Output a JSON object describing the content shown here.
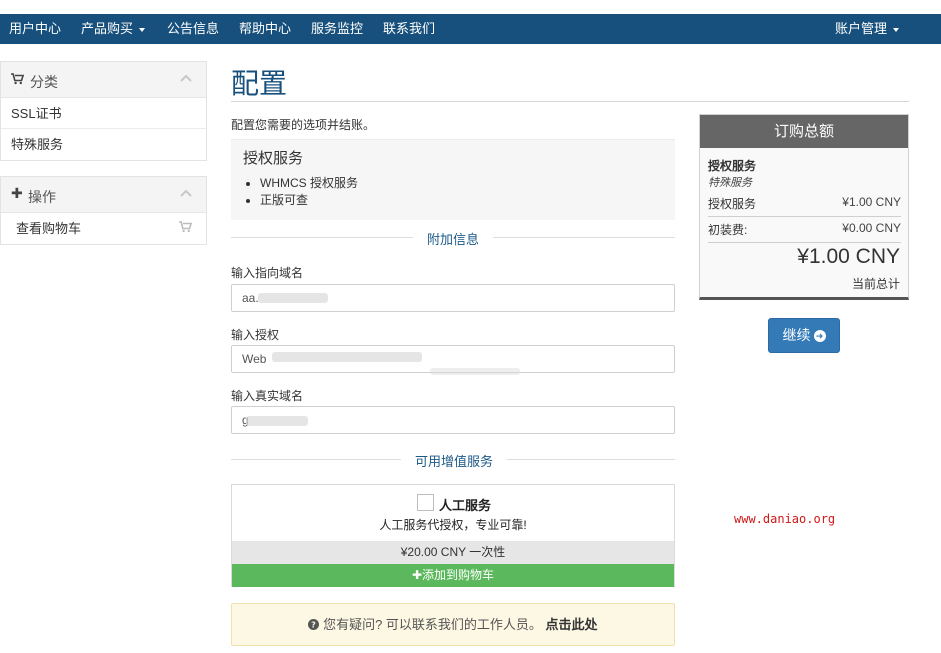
{
  "nav": {
    "items": [
      "用户中心",
      "产品购买",
      "公告信息",
      "帮助中心",
      "服务监控",
      "联系我们"
    ],
    "account": "账户管理"
  },
  "sidebar": {
    "categories": {
      "title": "分类",
      "items": [
        "SSL证书",
        "特殊服务"
      ]
    },
    "actions": {
      "title": "操作",
      "items": [
        "查看购物车"
      ]
    }
  },
  "main": {
    "title": "配置",
    "intro": "配置您需要的选项并结账。",
    "product": {
      "name": "授权服务",
      "features": [
        "WHMCS 授权服务",
        "正版可查"
      ]
    },
    "additional_info": {
      "heading": "附加信息",
      "fields": [
        {
          "label": "输入指向域名",
          "value": "aa."
        },
        {
          "label": "输入授权",
          "value": "Web"
        },
        {
          "label": "输入真实域名",
          "value": "g"
        }
      ]
    },
    "addons": {
      "heading": "可用增值服务",
      "items": [
        {
          "name": "人工服务",
          "description": "人工服务代授权，专业可靠!",
          "price": "¥20.00 CNY 一次性",
          "button": "添加到购物车"
        }
      ]
    },
    "help": {
      "text": "您有疑问? 可以联系我们的工作人员。",
      "link": "点击此处"
    }
  },
  "summary": {
    "title": "订购总额",
    "product": "授权服务",
    "group": "特殊服务",
    "lines": [
      {
        "label": "授权服务",
        "value": "¥1.00 CNY"
      },
      {
        "label": "初装费:",
        "value": "¥0.00 CNY"
      }
    ],
    "total": "¥1.00 CNY",
    "total_label": "当前总计",
    "continue_button": "继续"
  },
  "watermark": "www.daniao.org",
  "colors": {
    "nav": "#17507c",
    "accent": "#337ab7",
    "success": "#5cb85c",
    "summary_header": "#666666"
  }
}
